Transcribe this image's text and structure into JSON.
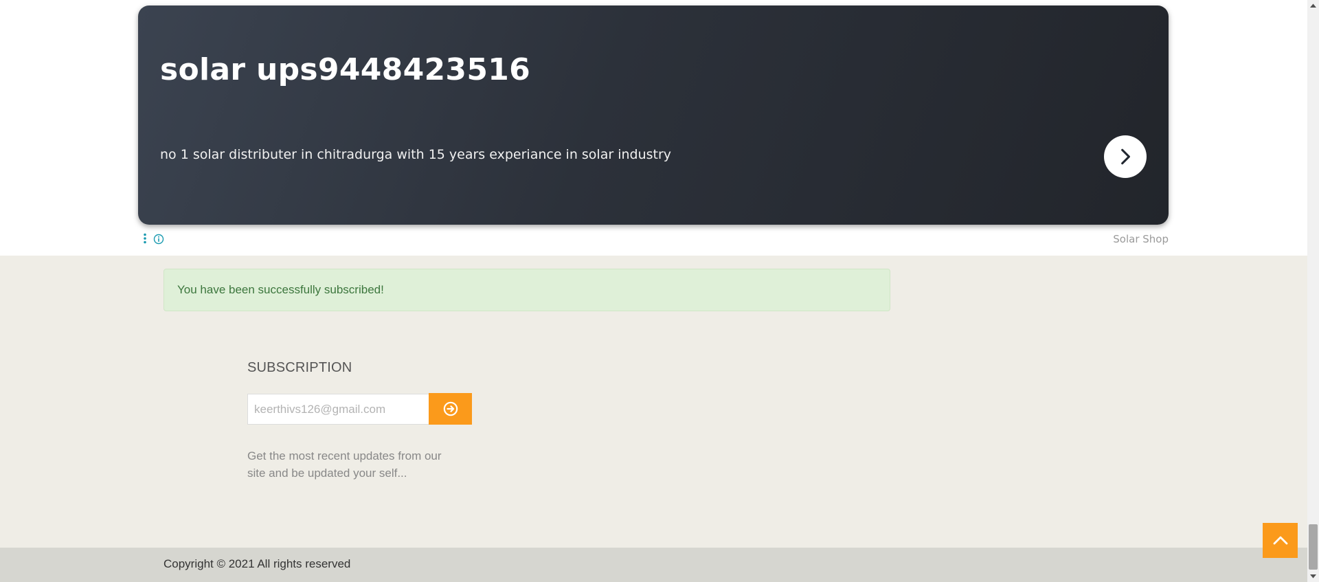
{
  "ad": {
    "title": "solar ups9448423516",
    "description": "no 1 solar distributer in chitradurga with 15 years experiance in solar industry",
    "advertiser": "Solar Shop",
    "arrow_icon": "chevron-right-icon",
    "options_icon": "vertical-dots-icon",
    "info_icon": "info-icon"
  },
  "alert": {
    "message": "You have been successfully subscribed!",
    "color": "#dff0d8"
  },
  "subscription": {
    "heading": "SUBSCRIPTION",
    "email_placeholder": "keerthivs126@gmail.com",
    "submit_icon": "arrow-circle-right-icon",
    "description": "Get the most recent updates from our site and be updated your self..."
  },
  "footer": {
    "copyright": "Copyright © 2021 All rights reserved"
  },
  "back_to_top": {
    "icon": "chevron-up-icon"
  },
  "colors": {
    "accent": "#fb9a1b",
    "page_background": "#efede6",
    "footer_background": "#d6d6d0"
  }
}
